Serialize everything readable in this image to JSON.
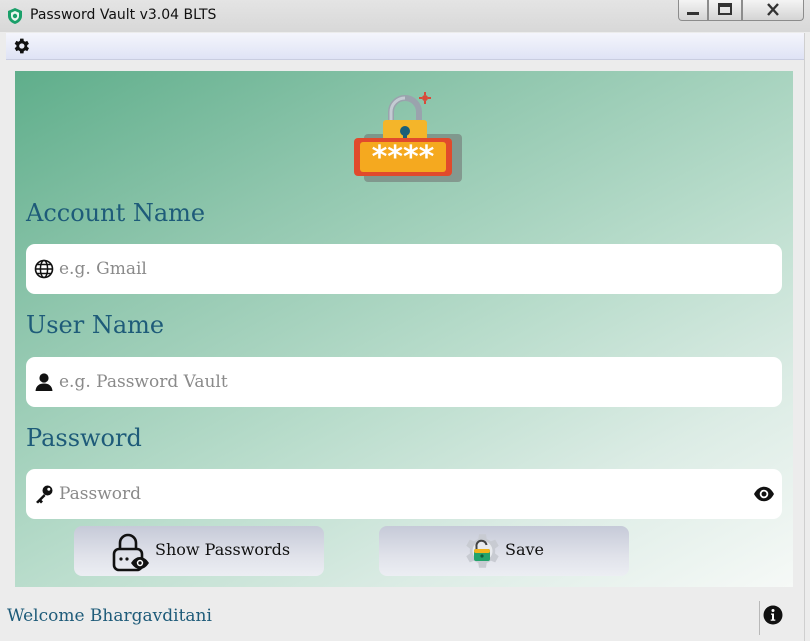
{
  "window": {
    "title": "Password Vault v3.04 BLTS",
    "icons": [
      "shield-icon",
      "minimize-icon",
      "maximize-icon",
      "close-icon"
    ]
  },
  "toolbar": {
    "settings_icon": "gear-icon"
  },
  "logo": {
    "icon": "padlock-password-icon",
    "mask_text": "****"
  },
  "form": {
    "account": {
      "label": "Account Name",
      "placeholder": "e.g. Gmail",
      "value": "",
      "icon": "globe-icon"
    },
    "user": {
      "label": "User Name",
      "placeholder": "e.g. Password Vault",
      "value": "",
      "icon": "user-icon"
    },
    "password": {
      "label": "Password",
      "placeholder": "Password",
      "value": "",
      "icon": "key-icon",
      "toggle_icon": "eye-icon"
    }
  },
  "actions": {
    "show_label": "Show Passwords",
    "show_icon": "lock-eye-icon",
    "save_label": "Save",
    "save_icon": "gear-lock-icon"
  },
  "status": {
    "welcome": "Welcome Bhargavditani",
    "info_icon": "info-icon"
  },
  "colors": {
    "accent": "#1e5b79",
    "panel_start": "#5fae8b",
    "panel_end": "#f6f9f7"
  }
}
